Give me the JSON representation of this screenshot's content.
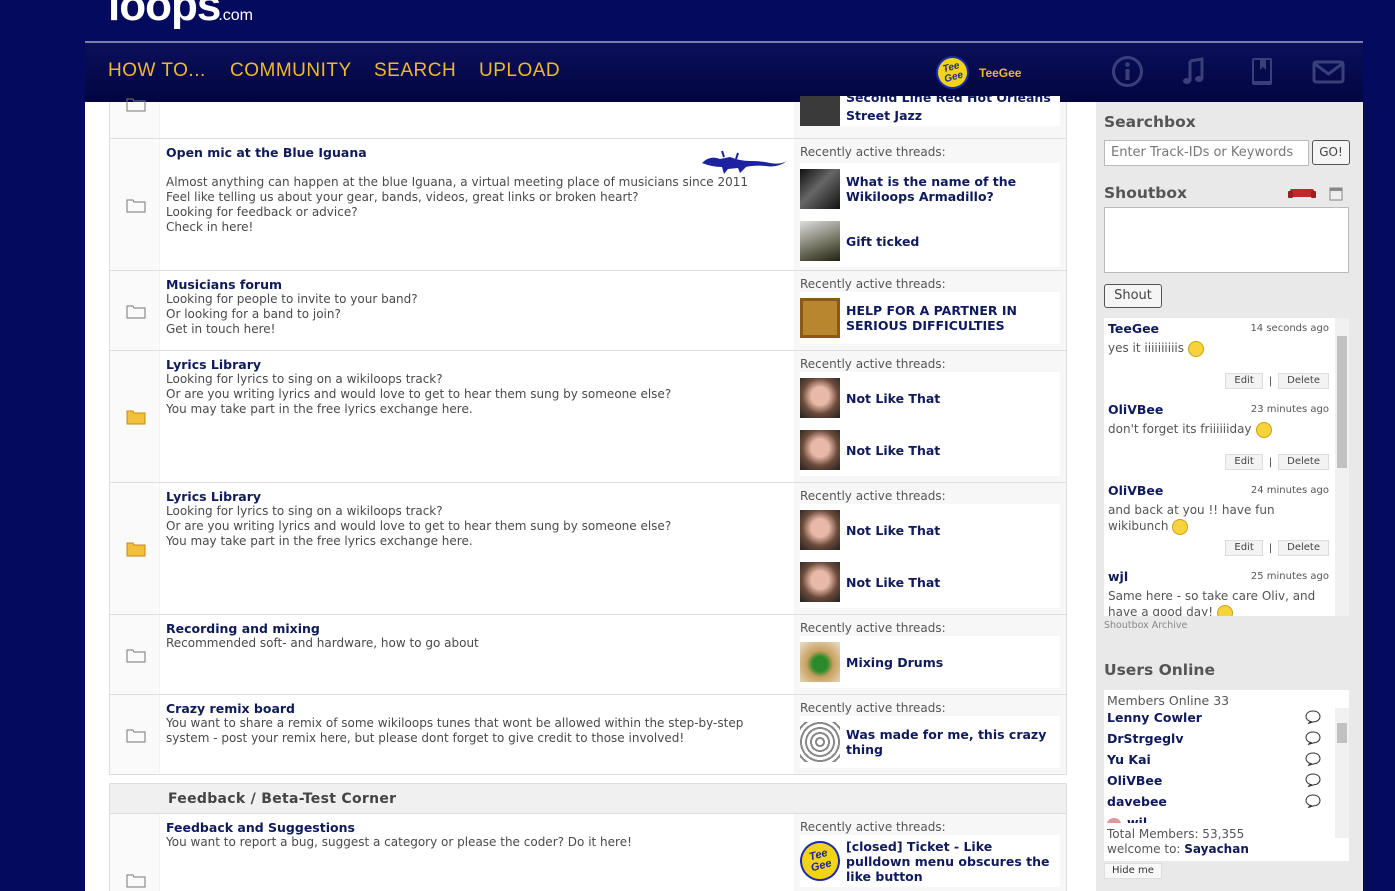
{
  "logo": {
    "main": "loops",
    "suffix": ".com"
  },
  "nav": {
    "items": [
      "HOW TO...",
      "COMMUNITY",
      "SEARCH",
      "UPLOAD"
    ],
    "user": {
      "name": "TeeGee",
      "avatar_text": "Tee Gee"
    },
    "icons": [
      "info-icon",
      "music-note-icon",
      "book-icon",
      "mail-icon"
    ]
  },
  "forums": [
    {
      "title": "",
      "text": "",
      "label": "",
      "threads": [
        "Street Jazz"
      ],
      "cut_thread": "Second Line Red Hot Orleans",
      "folder": "outline"
    },
    {
      "title": "Open mic at the Blue Iguana",
      "text": "Almost anything can happen at the blue Iguana, a virtual meeting place of musicians since 2011\nFeel like telling us about your gear, bands, videos, great links or broken heart?\nLooking for feedback or advice?\nCheck in here!",
      "label": "Recently active threads:",
      "threads": [
        "What is the name of the Wikiloops Armadillo?",
        "Gift ticked"
      ],
      "folder": "outline"
    },
    {
      "title": "Musicians forum",
      "text": "Looking for people to invite to your band?\nOr looking for a band to join?\nGet in touch here!",
      "label": "Recently active threads:",
      "threads": [
        "HELP FOR A PARTNER IN SERIOUS DIFFICULTIES"
      ],
      "folder": "outline"
    },
    {
      "title": "Lyrics Library",
      "text": "Looking for lyrics to sing on a wikiloops track?\nOr are you writing lyrics and would love to get to hear them sung by someone else?\nYou may take part in the free lyrics exchange here.",
      "label": "Recently active threads:",
      "threads": [
        "Not Like That",
        "Not Like That"
      ],
      "folder": "filled"
    },
    {
      "title": "Lyrics Library",
      "text": "Looking for lyrics to sing on a wikiloops track?\nOr are you writing lyrics and would love to get to hear them sung by someone else?\nYou may take part in the free lyrics exchange here.",
      "label": "Recently active threads:",
      "threads": [
        "Not Like That",
        "Not Like That"
      ],
      "folder": "filled"
    },
    {
      "title": "Recording and mixing",
      "text": "Recommended soft- and hardware, how to go about",
      "label": "Recently active threads:",
      "threads": [
        "Mixing Drums"
      ],
      "folder": "outline"
    },
    {
      "title": "Crazy remix board",
      "text": "You want to share a remix of some wikiloops tunes that wont be allowed within the step-by-step system - post your remix here, but please dont forget to give credit to those involved!",
      "label": "Recently active threads:",
      "threads": [
        "Was made for me, this crazy thing"
      ],
      "folder": "outline"
    }
  ],
  "section": {
    "title": "Feedback / Beta-Test Corner"
  },
  "feedback_forum": {
    "title": "Feedback and Suggestions",
    "text": "You want to report a bug, suggest a category or please the coder? Do it here!",
    "label": "Recently active threads:",
    "threads": [
      "[closed] Ticket - Like pulldown menu obscures the like button"
    ]
  },
  "sidebar": {
    "searchbox": {
      "title": "Searchbox",
      "placeholder": "Enter Track-IDs or Keywords",
      "go": "GO!"
    },
    "shoutbox": {
      "title": "Shoutbox",
      "button": "Shout",
      "messages": [
        {
          "user": "TeeGee",
          "time": "14 seconds ago",
          "text": "yes it iiiiiiiiiis",
          "smiley": true,
          "edit": "Edit",
          "delete": "Delete"
        },
        {
          "user": "OliVBee",
          "time": "23 minutes ago",
          "text": "don't forget its friiiiiiday",
          "smiley": true,
          "edit": "Edit",
          "delete": "Delete"
        },
        {
          "user": "OliVBee",
          "time": "24 minutes ago",
          "text": "and back at you !! have fun wikibunch",
          "smiley": true,
          "edit": "Edit",
          "delete": "Delete"
        },
        {
          "user": "wjl",
          "time": "25 minutes ago",
          "text": "Same here - so take care Oliv, and have a good day!",
          "smiley": true
        }
      ],
      "archive": "Shoutbox Archive"
    },
    "users_online": {
      "title": "Users Online",
      "count_label": "Members Online 33",
      "members": [
        "Lenny Cowler",
        "DrStrgeglv",
        "Yu Kai",
        "OliVBee",
        "davebee",
        "wil"
      ],
      "total": "Total Members: 53,355",
      "welcome_label": "welcome to:",
      "welcome_name": "Sayachan",
      "hide": "Hide me"
    }
  },
  "colors": {
    "background": "#040a5e",
    "accent": "#f0b92a",
    "link": "#0f1a5c"
  }
}
